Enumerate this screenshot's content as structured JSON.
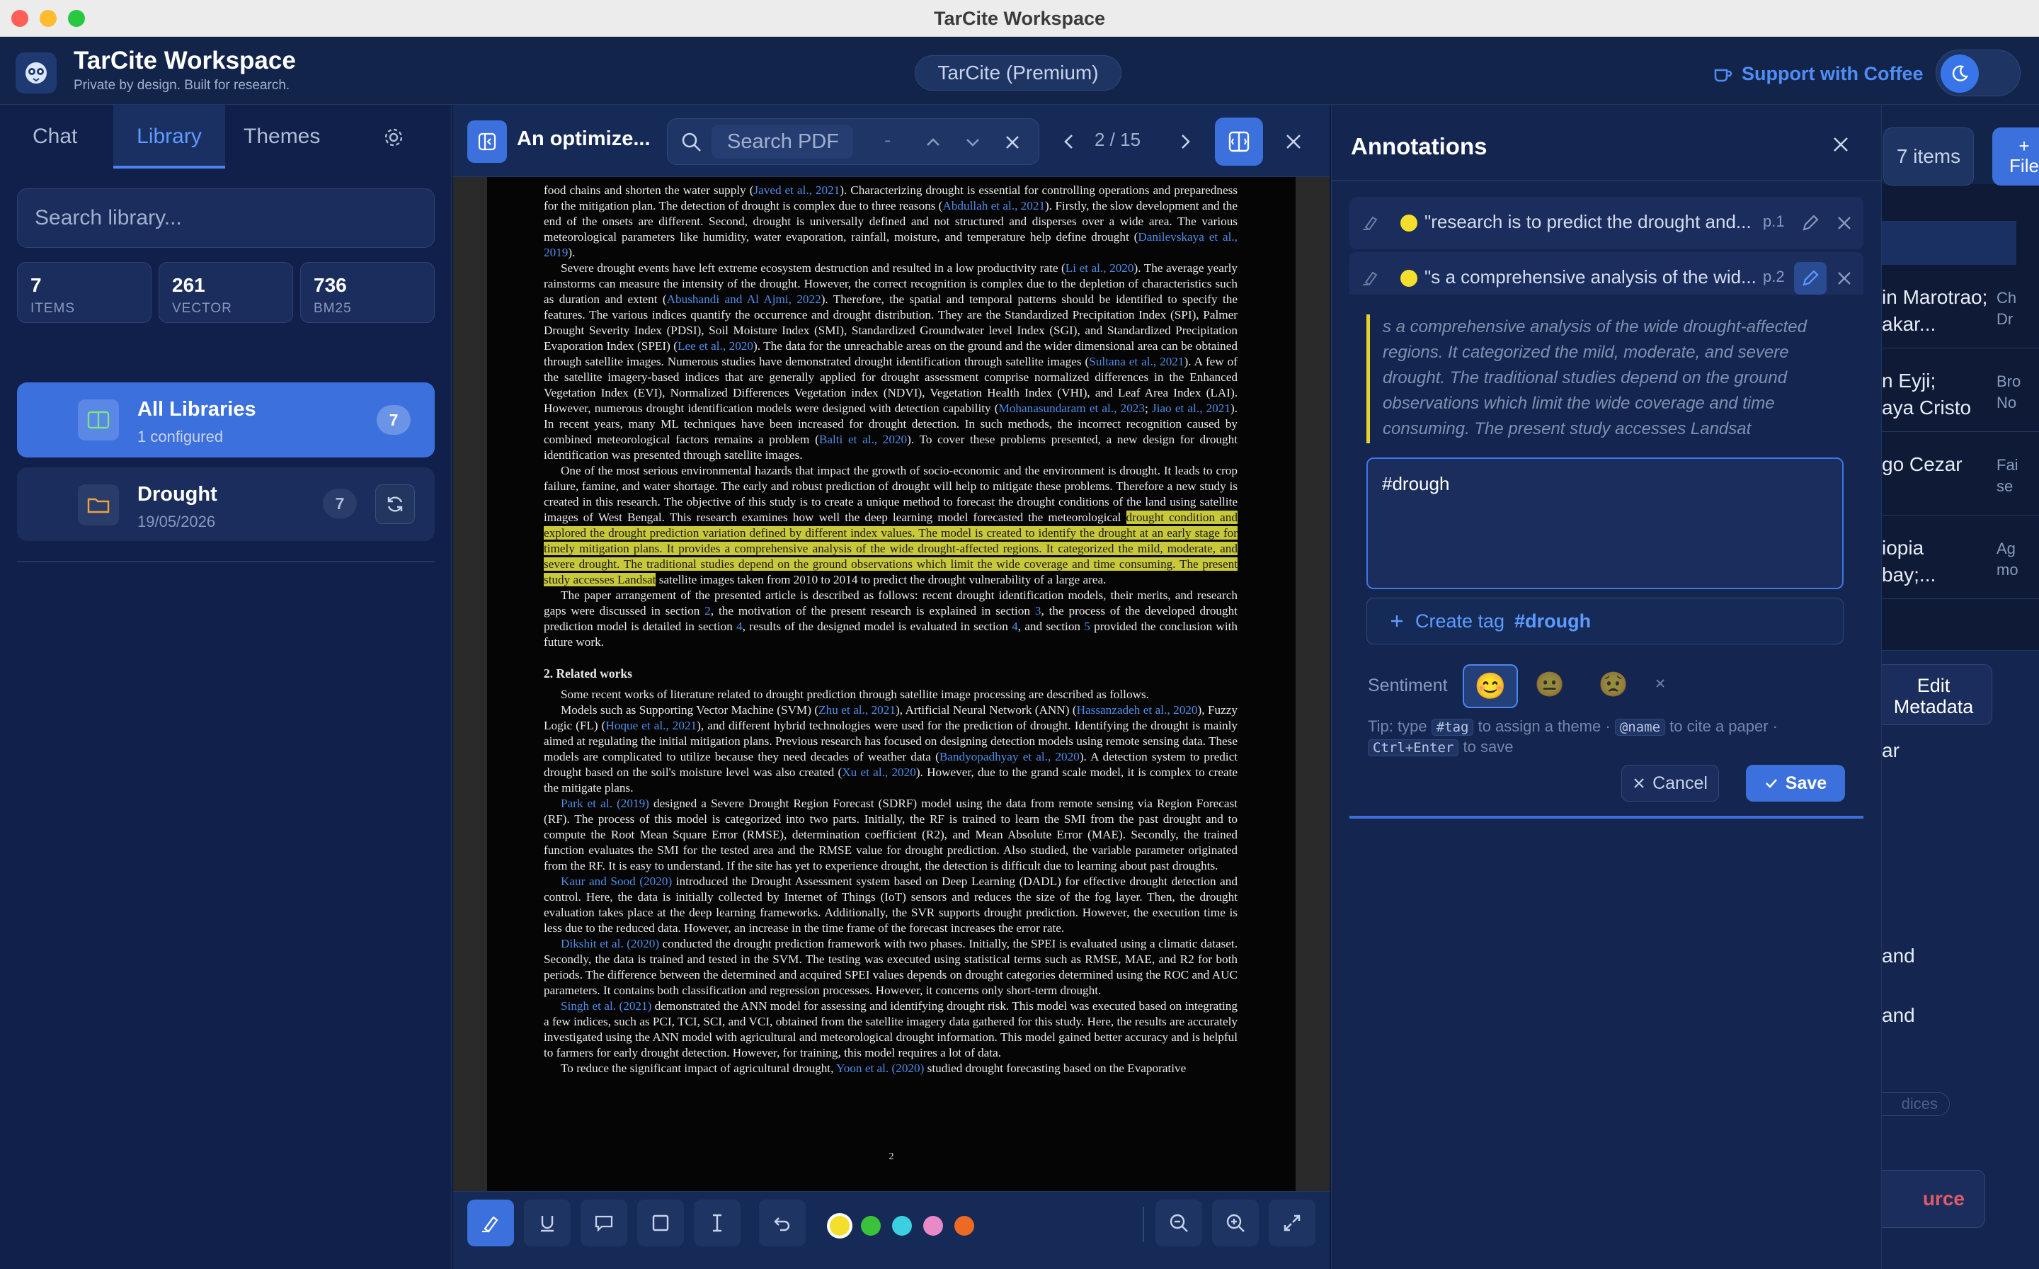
{
  "window": {
    "title": "TarCite Workspace"
  },
  "header": {
    "app_name": "TarCite Workspace",
    "tagline": "Private by design. Built for research.",
    "plan": "TarCite (Premium)",
    "support": "Support with Coffee"
  },
  "sidebar": {
    "tabs": [
      "Chat",
      "Library",
      "Themes"
    ],
    "search_placeholder": "Search library...",
    "stats": [
      {
        "value": "7",
        "label": "ITEMS"
      },
      {
        "value": "261",
        "label": "VECTOR"
      },
      {
        "value": "736",
        "label": "BM25"
      }
    ],
    "libraries": [
      {
        "name": "All Libraries",
        "sub": "1 configured",
        "count": "7"
      },
      {
        "name": "Drought",
        "sub": "19/05/2026",
        "count": "7"
      }
    ]
  },
  "pdf": {
    "title": "An optimize...",
    "search_placeholder": "Search PDF",
    "match": "-",
    "page": "2 / 15",
    "page_number": "2"
  },
  "annotations": {
    "title": "Annotations",
    "items": [
      {
        "text": "\"research is to predict the drought and...",
        "page": "p.1"
      },
      {
        "text": "\"s a comprehensive analysis of the wid...",
        "page": "p.2"
      }
    ],
    "quote": "s a comprehensive analysis of the wide drought-affected regions. It categorized the mild, moderate, and severe drought. The traditional studies depend on the ground observations which limit the wide coverage and time consuming. The present study accesses Landsat",
    "note": "#drough",
    "create_tag_label": "Create tag",
    "create_tag_value": "#drough",
    "sentiment_label": "Sentiment",
    "sentiments": [
      "😊",
      "😐",
      "😟"
    ],
    "tip": {
      "prefix": "Tip: type",
      "tag": "#tag",
      "mid1": "to assign a theme ·",
      "name": "@name",
      "mid2": "to cite a paper ·",
      "keys": "Ctrl+Enter",
      "suffix": "to save"
    },
    "cancel": "Cancel",
    "save": "Save"
  },
  "right_edge": {
    "items_count": "7 items",
    "add": "+",
    "add2": "File",
    "rows": [
      {
        "a": "in Marotrao;",
        "b": "akar...",
        "c": "Ch",
        "d": "Dr"
      },
      {
        "a": "n Eyji;",
        "b": "aya Cristo",
        "c": "Bro",
        "d": "No"
      },
      {
        "a": "go Cezar",
        "b": "",
        "c": "Fai",
        "d": "se"
      },
      {
        "a": "iopia",
        "b": "bay;...",
        "c": "Ag",
        "d": "mo"
      }
    ],
    "edit_metadata_1": "Edit",
    "edit_metadata_2": "Metadata",
    "frag_ar": "ar",
    "frag_and1": "and",
    "frag_and2": "and",
    "frag_dices": "dices",
    "frag_urce": "urce"
  },
  "colors": {
    "accent": "#3c70dc",
    "highlight": "#f4e02c",
    "swatches": [
      "#f4e02c",
      "#3ac23a",
      "#3ad0e0",
      "#e88ac8",
      "#ee6a22"
    ]
  },
  "pdf_body": {
    "p1": "food chains and shorten the water supply (",
    "p1c1": "Javed et al., 2021",
    "p1b": "). Characterizing drought is essential for controlling operations and preparedness for the mitigation plan. The detection of drought is complex due to three reasons (",
    "p1c2": "Abdullah et al., 2021",
    "p1d": "). Firstly, the slow development and the end of the onsets are different. Second, drought is universally defined and not structured and disperses over a wide area. The various meteorological parameters like humidity, water evaporation, rainfall, moisture, and temperature help define drought (",
    "p1c3": "Danilevskaya et al., 2019",
    "p1e": ").",
    "p2a": "Severe drought events have left extreme ecosystem destruction and resulted in a low productivity rate (",
    "p2c1": "Li et al., 2020",
    "p2b": "). The average yearly rainstorms can measure the intensity of the drought. However, the correct recognition is complex due to the depletion of characteristics such as duration and extent (",
    "p2c2": "Abushandi and Al Ajmi, 2022",
    "p2c": "). Therefore, the spatial and temporal patterns should be identified to specify the features. The various indices quantify the occurrence and drought distribution. They are the Standardized Precipitation Index (SPI), Palmer Drought Severity Index (PDSI), Soil Moisture Index (SMI), Standardized Groundwater level Index (SGI), and Standardized Precipitation Evaporation Index (SPEI) (",
    "p2c3": "Lee et al., 2020",
    "p2d": "). The data for the unreachable areas on the ground and the wider dimensional area can be obtained through satellite images. Numerous studies have demonstrated drought identification through satellite images (",
    "p2c4": "Sultana et al., 2021",
    "p2e": "). A few of the satellite imagery-based indices that are generally applied for drought assessment comprise normalized differences in the Enhanced Vegetation Index (EVI), Normalized Differences Vegetation index (NDVI), Vegetation Health Index (VHI), and Leaf Area Index (LAI). However, numerous drought identification models were designed with detection capability (",
    "p2c5": "Mohanasundaram et al., 2023",
    "p2f": "; ",
    "p2c6": "Jiao et al., 2021",
    "p2g": "). In recent years, many ML techniques have been increased for drought detection. In such methods, the incorrect recognition caused by combined meteorological factors remains a problem (",
    "p2c7": "Balti et al., 2020",
    "p2h": "). To cover these problems presented, a new design for drought identification was presented through satellite images.",
    "p3a": "One of the most serious environmental hazards that impact the growth of socio-economic and the environment is drought. It leads to crop failure, famine, and water shortage. The early and robust prediction of drought will help to mitigate these problems. Therefore a new study is created in this research. The objective of this study is to create a unique method to forecast the drought conditions of the land using satellite images of West Bengal. This research examines how well the deep learning model forecasted the meteorological ",
    "p3hl": "drought condition and explored the drought prediction variation defined by different index values. The model is created to identify the drought at an early stage for timely mitigation plans. It provides a comprehensive analysis of the wide drought-affected regions. It categorized the mild, moderate, and severe drought. The traditional studies depend on the ground observations which limit the wide coverage and time consuming. The present study accesses Landsat",
    "p3b": " satellite images taken from 2010 to 2014 to predict the drought vulnerability of a large area.",
    "p4a": "The paper arrangement of the presented article is described as follows: recent drought identification models, their merits, and research gaps were discussed in section ",
    "p4s2": "2",
    "p4b": ", the motivation of the present research is explained in section ",
    "p4s3": "3",
    "p4c": ", the process of the developed drought prediction model is detailed in section ",
    "p4s4": "4",
    "p4d": ", results of the designed model is evaluated in section ",
    "p4s4b": "4",
    "p4e": ", and section ",
    "p4s5": "5",
    "p4f": " provided the conclusion with future work.",
    "h2": "2.  Related works",
    "p5": "Some recent works of literature related to drought prediction through satellite image processing are described as follows.",
    "p6a": "Models such as Supporting Vector Machine (SVM) (",
    "p6c1": "Zhu et al., 2021",
    "p6b": "), Artificial Neural Network (ANN) (",
    "p6c2": "Hassanzadeh et al., 2020",
    "p6c": "), Fuzzy Logic (FL) (",
    "p6c3": "Hoque et al., 2021",
    "p6d": "), and different hybrid technologies were used for the prediction of drought. Identifying the drought is mainly aimed at regulating the initial mitigation plans. Previous research has focused on designing detection models using remote sensing data. These models are complicated to utilize because they need decades of weather data (",
    "p6c4": "Bandyopadhyay et al., 2020",
    "p6e": "). A detection system to predict drought based on the soil's moisture level was also created (",
    "p6c5": "Xu et al., 2020",
    "p6f": "). However, due to the grand scale model, it is complex to create the mitigate plans.",
    "p7c": "Park et al. (2019)",
    "p7": " designed a Severe Drought Region Forecast (SDRF) model using the data from remote sensing via Region Forecast (RF). The process of this model is categorized into two parts. Initially, the RF is trained to learn the SMI from the past drought and to compute the Root Mean Square Error (RMSE), determination coefficient (R2), and Mean Absolute Error (MAE). Secondly, the trained function evaluates the SMI for the tested area and the RMSE value for drought prediction. Also studied, the variable parameter originated from the RF. It is easy to understand. If the site has yet to experience drought, the detection is difficult due to learning about past droughts.",
    "p8c": "Kaur and Sood (2020)",
    "p8": " introduced the Drought Assessment system based on Deep Learning (DADL) for effective drought detection and control. Here, the data is initially collected by Internet of Things (IoT) sensors and reduces the size of the fog layer. Then, the drought evaluation takes place at the deep learning frameworks. Additionally, the SVR supports drought prediction. However, the execution time is less due to the reduced data. However, an increase in the time frame of the forecast increases the error rate.",
    "p9c": "Dikshit et al. (2020)",
    "p9": " conducted the drought prediction framework with two phases. Initially, the SPEI is evaluated using a climatic dataset. Secondly, the data is trained and tested in the SVM. The testing was executed using statistical terms such as RMSE, MAE, and R2 for both periods. The difference between the determined and acquired SPEI values depends on drought categories determined using the ROC and AUC parameters. It contains both classification and regression processes. However, it concerns only short-term drought.",
    "p10c": "Singh et al. (2021)",
    "p10": " demonstrated the ANN model for assessing and identifying drought risk. This model was executed based on integrating a few indices, such as PCI, TCI, SCI, and VCI, obtained from the satellite imagery data gathered for this study. Here, the results are accurately investigated using the ANN model with agricultural and meteorological drought information. This model gained better accuracy and is helpful to farmers for early drought detection. However, for training, this model requires a lot of data.",
    "p11a": "To reduce the significant impact of agricultural drought, ",
    "p11c": "Yoon et al. (2020)",
    "p11b": " studied drought forecasting based on the Evaporative"
  }
}
